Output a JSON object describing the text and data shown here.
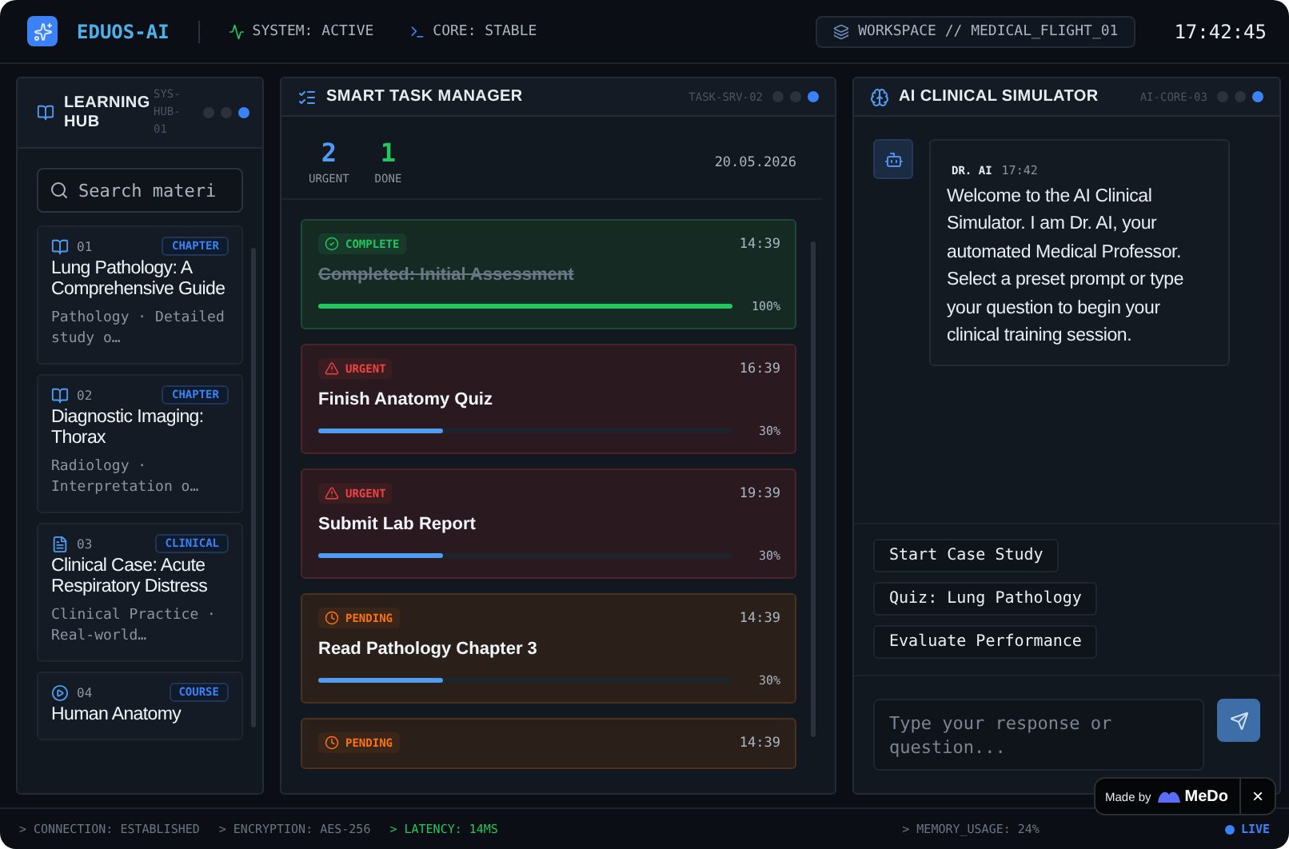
{
  "header": {
    "brand": "EDUOS-AI",
    "system": "SYSTEM: ACTIVE",
    "core": "CORE: STABLE",
    "workspace": "WORKSPACE // MEDICAL_FLIGHT_01",
    "clock": "17:42:45"
  },
  "learning_hub": {
    "title": "LEARNING HUB",
    "code": "SYS-HUB-01",
    "search": {
      "placeholder": "Search materi"
    },
    "items": [
      {
        "kind": "book",
        "number": "01",
        "tag": "CHAPTER",
        "title": "Lung Pathology: A Comprehensive Guide",
        "subtitle": "Pathology · Detailed study o…"
      },
      {
        "kind": "book",
        "number": "02",
        "tag": "CHAPTER",
        "title": "Diagnostic Imaging: Thorax",
        "subtitle": "Radiology · Interpretation o…"
      },
      {
        "kind": "file",
        "number": "03",
        "tag": "CLINICAL",
        "title": "Clinical Case: Acute Respiratory Distress",
        "subtitle": "Clinical Practice · Real-world…"
      },
      {
        "kind": "course",
        "number": "04",
        "tag": "COURSE",
        "title": "Human Anatomy"
      }
    ]
  },
  "task_manager": {
    "title": "SMART TASK MANAGER",
    "code": "TASK-SRV-02",
    "stats": [
      {
        "value": "2",
        "label": "URGENT",
        "kind": "urgent"
      },
      {
        "value": "1",
        "label": "DONE",
        "kind": "done"
      }
    ],
    "date": "20.05.2026",
    "tasks": [
      {
        "kind": "complete",
        "status": "COMPLETE",
        "time": "14:39",
        "title": "Completed: Initial Assessment",
        "level": 1,
        "percent": "100%"
      },
      {
        "kind": "urgent",
        "status": "URGENT",
        "time": "16:39",
        "title": "Finish Anatomy Quiz",
        "level": 0.3,
        "percent": "30%"
      },
      {
        "kind": "urgent",
        "status": "URGENT",
        "time": "19:39",
        "title": "Submit Lab Report",
        "level": 0.3,
        "percent": "30%"
      },
      {
        "kind": "pending",
        "status": "PENDING",
        "time": "14:39",
        "title": "Read Pathology Chapter 3",
        "level": 0.3,
        "percent": "30%"
      },
      {
        "kind": "pending",
        "status": "PENDING",
        "time": "14:39"
      }
    ]
  },
  "simulator": {
    "title": "AI CLINICAL SIMULATOR",
    "code": "AI-CORE-03",
    "message": {
      "sender": "DR. AI",
      "time": "17:42",
      "text": "Welcome to the AI Clinical Simulator. I am Dr. AI, your automated Medical Professor. Select a preset prompt or type your question to begin your clinical training session."
    },
    "prompts": [
      "Start Case Study",
      "Quiz: Lung Pathology",
      "Evaluate Performance"
    ],
    "input": {
      "placeholder": "Type your response or question..."
    }
  },
  "status_bar": {
    "left": [
      {
        "text": "> CONNECTION: ESTABLISHED",
        "kind": "normal"
      },
      {
        "text": "> ENCRYPTION: AES-256",
        "kind": "normal"
      },
      {
        "text": "> LATENCY: 14MS",
        "kind": "good"
      }
    ],
    "right": [
      "> MEMORY_USAGE: 24%"
    ],
    "live": "LIVE"
  },
  "badge": {
    "prefix": "Made by",
    "brand": "MeDo",
    "close": "×"
  }
}
